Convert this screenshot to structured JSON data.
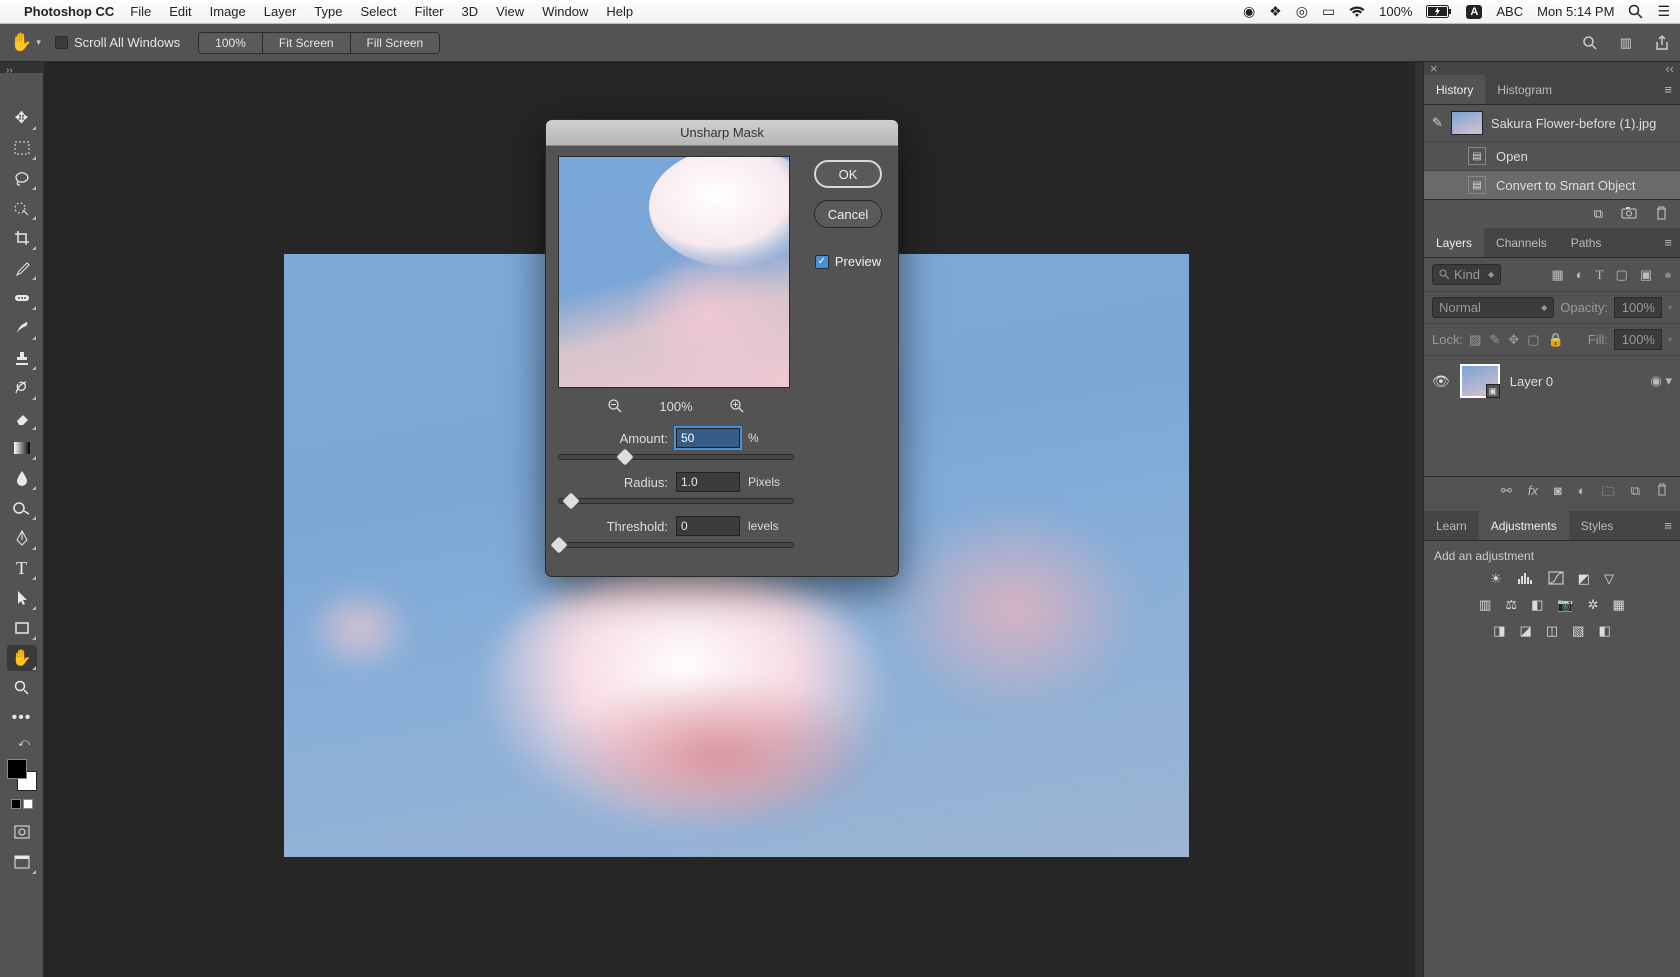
{
  "menubar": {
    "app": "Photoshop CC",
    "items": [
      "File",
      "Edit",
      "Image",
      "Layer",
      "Type",
      "Select",
      "Filter",
      "3D",
      "View",
      "Window",
      "Help"
    ],
    "battery": "100%",
    "input_badge": "A",
    "input_label": "ABC",
    "clock": "Mon 5:14 PM"
  },
  "options_bar": {
    "scroll_all": "Scroll All Windows",
    "zoom": "100%",
    "fit": "Fit Screen",
    "fill": "Fill Screen"
  },
  "dialog": {
    "title": "Unsharp Mask",
    "ok": "OK",
    "cancel": "Cancel",
    "preview_label": "Preview",
    "preview_checked": true,
    "zoom": "100%",
    "amount": {
      "label": "Amount:",
      "value": "50",
      "unit": "%",
      "slider_pct": 28
    },
    "radius": {
      "label": "Radius:",
      "value": "1.0",
      "unit": "Pixels",
      "slider_pct": 5
    },
    "threshold": {
      "label": "Threshold:",
      "value": "0",
      "unit": "levels",
      "slider_pct": 0
    }
  },
  "panels": {
    "history": {
      "tab": "History",
      "histogram_tab": "Histogram",
      "file": "Sakura Flower-before (1).jpg",
      "steps": [
        "Open",
        "Convert to Smart Object"
      ]
    },
    "layers": {
      "tab": "Layers",
      "channels_tab": "Channels",
      "paths_tab": "Paths",
      "kind_label": "Kind",
      "blend": "Normal",
      "opacity_label": "Opacity:",
      "opacity": "100%",
      "lock_label": "Lock:",
      "fill_label": "Fill:",
      "fill": "100%",
      "layer0": "Layer 0"
    },
    "adjustments": {
      "learn_tab": "Learn",
      "tab": "Adjustments",
      "styles_tab": "Styles",
      "heading": "Add an adjustment"
    }
  }
}
